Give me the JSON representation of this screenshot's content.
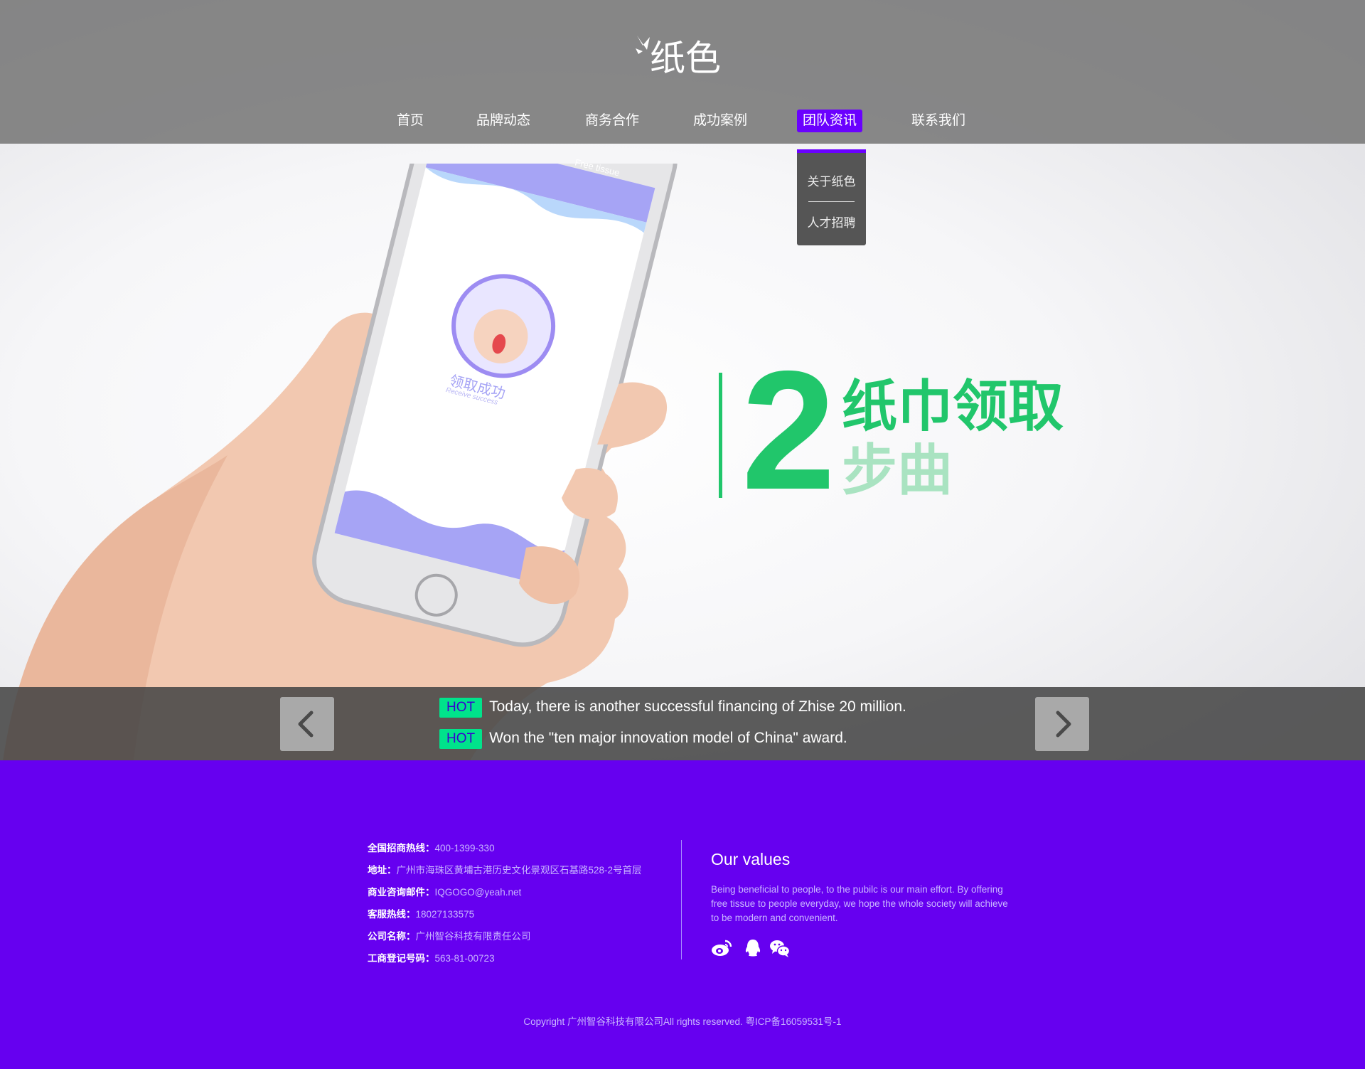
{
  "brand": {
    "logo_text": "纸色"
  },
  "nav": {
    "items": [
      {
        "label": "首页"
      },
      {
        "label": "品牌动态"
      },
      {
        "label": "商务合作"
      },
      {
        "label": "成功案例"
      },
      {
        "label": "团队资讯",
        "active": true
      },
      {
        "label": "联系我们"
      }
    ],
    "dropdown": [
      "关于纸色",
      "人才招聘"
    ]
  },
  "phone_screen": {
    "title": "Free tissue",
    "status_cn": "领取成功",
    "status_en": "Receive success"
  },
  "hero": {
    "step_number": "2",
    "step_title": "纸巾领取",
    "step_subtitle": "步曲"
  },
  "news": {
    "badge": "HOT",
    "items": [
      "Today, there is another successful financing of Zhise 20 million.",
      "Won the \"ten major innovation model of China\" award."
    ]
  },
  "footer": {
    "contacts": [
      {
        "label": "全国招商热线：",
        "value": "400-1399-330"
      },
      {
        "label": "地址：",
        "value": "广州市海珠区黄埔古港历史文化景观区石基路528-2号首层"
      },
      {
        "label": "商业咨询邮件：",
        "value": "IQGOGO@yeah.net"
      },
      {
        "label": "客服热线：",
        "value": "18027133575"
      },
      {
        "label": "公司名称：",
        "value": "广州智谷科技有限责任公司"
      },
      {
        "label": "工商登记号码：",
        "value": "563-81-00723"
      }
    ],
    "values_title": "Our values",
    "values_text": "Being beneficial to people, to the pubilc is our main effort. By offering free tissue to people everyday, we hope the whole society will achieve to be modern and convenient.",
    "social_icons": [
      "weibo-icon",
      "qq-icon",
      "wechat-icon"
    ],
    "copyright": "Copyright 广州智谷科技有限公司All rights reserved. 粤ICP备16059531号-1"
  },
  "colors": {
    "accent": "#6a00ff",
    "footer_bg": "#6600f0",
    "green": "#21c66b",
    "hot_badge": "#00e38b"
  }
}
